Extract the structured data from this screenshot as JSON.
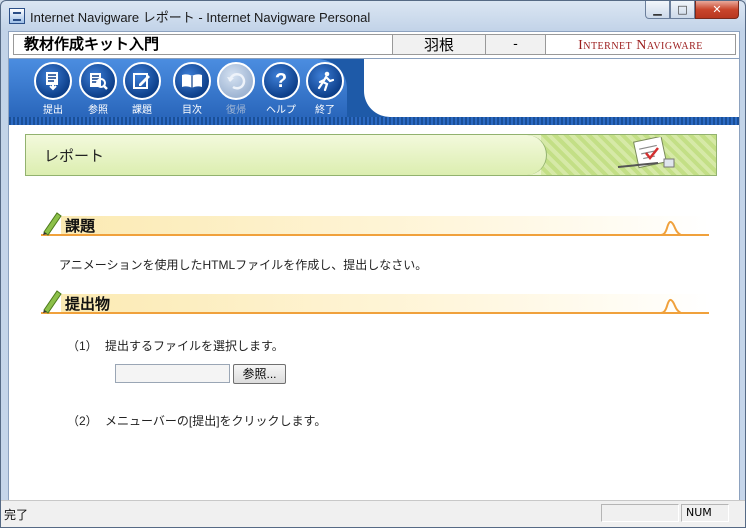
{
  "window": {
    "title": "Internet Navigware レポート - Internet Navigware Personal",
    "min_icon": "minimize-icon",
    "max_icon": "maximize-icon",
    "close_icon": "close-icon"
  },
  "infobar": {
    "course": "教材作成キット入門",
    "user": "羽根",
    "dash": "-",
    "brand": "Internet Navigware"
  },
  "toolbar": {
    "submit": "提出",
    "refer": "参照",
    "task": "課題",
    "contents": "目次",
    "return": "復帰",
    "help": "ヘルプ",
    "exit": "終了"
  },
  "banner": {
    "title": "レポート"
  },
  "section1": {
    "heading": "課題",
    "text": "アニメーションを使用したHTMLファイルを作成し、提出しなさい。"
  },
  "section2": {
    "heading": "提出物",
    "step1_num": "（1）",
    "step1_text": "提出するファイルを選択します。",
    "browse": "参照...",
    "step2_num": "（2）",
    "step2_text": "メニューバーの[提出]をクリックします。"
  },
  "status": {
    "text": "完了",
    "num": "NUM"
  },
  "colors": {
    "toolbar_blue": "#1e5aa8",
    "accent_orange": "#f0a13c",
    "banner_green": "#dceeb0",
    "brand_red": "#9b1b1b"
  }
}
